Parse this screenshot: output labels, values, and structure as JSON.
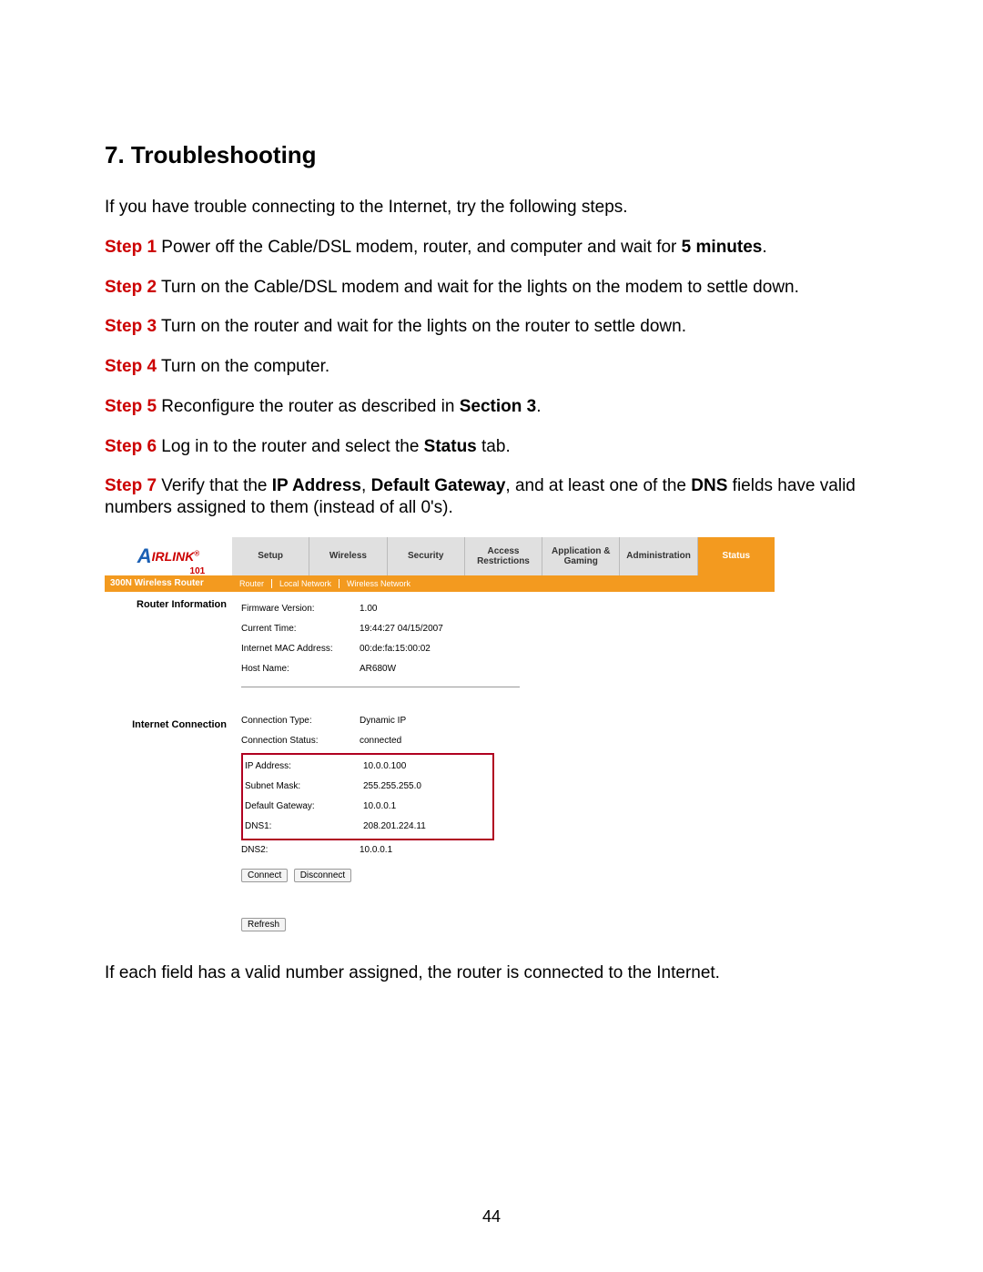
{
  "doc": {
    "title": "7. Troubleshooting",
    "intro": "If you have trouble connecting to the Internet, try the following steps.",
    "steps": [
      {
        "label": "Step 1",
        "lead": " Power off the Cable/DSL modem, router, and computer and wait for ",
        "bold": "5 minutes",
        "tail": "."
      },
      {
        "label": "Step 2",
        "lead": " Turn on the Cable/DSL modem and wait for the lights on the modem to settle down.",
        "bold": "",
        "tail": ""
      },
      {
        "label": "Step 3",
        "lead": " Turn on the router and wait for the lights on the router to settle down.",
        "bold": "",
        "tail": ""
      },
      {
        "label": "Step 4",
        "lead": " Turn on the computer.",
        "bold": "",
        "tail": ""
      },
      {
        "label": "Step 5",
        "lead": " Reconfigure the router as described in ",
        "bold": "Section 3",
        "tail": "."
      },
      {
        "label": "Step 6",
        "lead": " Log in to the router and select the ",
        "bold": "Status",
        "tail": " tab."
      }
    ],
    "step7": {
      "label": "Step 7",
      "part1": " Verify that the ",
      "b1": "IP Address",
      "sep1": ", ",
      "b2": "Default Gateway",
      "part2": ", and at least one of the ",
      "b3": "DNS",
      "part3": " fields have valid numbers assigned to them (instead of all 0's)."
    },
    "closing": "If each field has a valid number assigned, the router is connected to the Internet.",
    "page_number": "44"
  },
  "router": {
    "logo_text_a": "A",
    "logo_text_rest": "IRLINK",
    "logo_tm": "®",
    "logo_sub": "101",
    "tabs": [
      "Setup",
      "Wireless",
      "Security",
      "Access Restrictions",
      "Application & Gaming",
      "Administration",
      "Status"
    ],
    "model": "300N Wireless Router",
    "subtabs": [
      "Router",
      "Local Network",
      "Wireless Network"
    ],
    "sections": {
      "router_info_label": "Router Information",
      "internet_conn_label": "Internet Connection"
    },
    "router_info": [
      {
        "label": "Firmware Version:",
        "value": "1.00"
      },
      {
        "label": "Current Time:",
        "value": "19:44:27 04/15/2007"
      },
      {
        "label": "Internet MAC Address:",
        "value": "00:de:fa:15:00:02"
      },
      {
        "label": "Host Name:",
        "value": "AR680W"
      }
    ],
    "conn_top": [
      {
        "label": "Connection Type:",
        "value": "Dynamic IP"
      },
      {
        "label": "Connection Status:",
        "value": "connected"
      }
    ],
    "conn_highlight": [
      {
        "label": "IP Address:",
        "value": "10.0.0.100"
      },
      {
        "label": "Subnet Mask:",
        "value": "255.255.255.0"
      },
      {
        "label": "Default Gateway:",
        "value": "10.0.0.1"
      },
      {
        "label": "DNS1:",
        "value": "208.201.224.11"
      }
    ],
    "conn_bottom": [
      {
        "label": "DNS2:",
        "value": "10.0.0.1"
      }
    ],
    "buttons": {
      "connect": "Connect",
      "disconnect": "Disconnect",
      "refresh": "Refresh"
    }
  }
}
